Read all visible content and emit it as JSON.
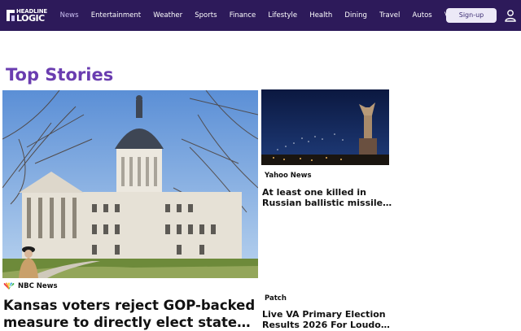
{
  "brand": {
    "line1": "HEADLINE",
    "line2": "LOGIC"
  },
  "nav": {
    "items": [
      "News",
      "Entertainment",
      "Weather",
      "Sports",
      "Finance",
      "Lifestyle",
      "Health",
      "Dining",
      "Travel",
      "Autos",
      "Video"
    ],
    "active_index": 0
  },
  "header": {
    "signup_label": "Sign-up"
  },
  "page": {
    "section_title": "Top Stories"
  },
  "stories": [
    {
      "source": "NBC News",
      "title_line1": "Kansas voters reject GOP-backed",
      "title_line2": "measure to directly elect state…"
    },
    {
      "source": "Yahoo News",
      "title_line1": "At least one killed in",
      "title_line2": "Russian ballistic missile…"
    },
    {
      "source": "Patch",
      "title_line1": "Live VA Primary Election",
      "title_line2": "Results 2026 For Loudo…"
    }
  ],
  "colors": {
    "topbar": "#2d1a5a",
    "accent": "#6a3db0",
    "signup_bg": "#ece9f7"
  }
}
